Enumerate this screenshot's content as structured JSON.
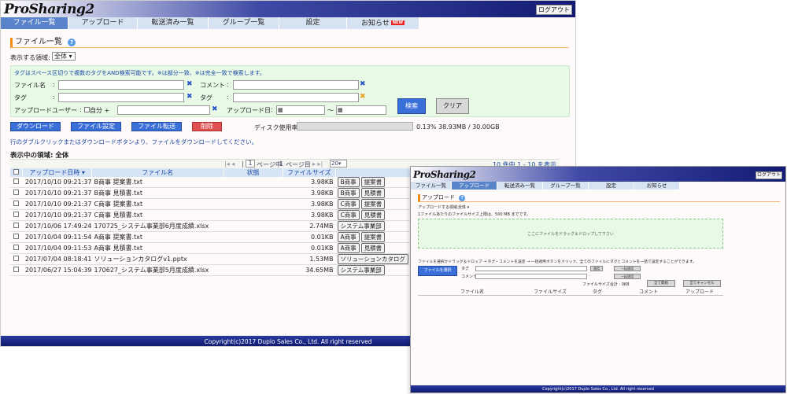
{
  "main": {
    "logo": "ProSharing2",
    "logout": "ログアウト",
    "nav": [
      "ファイル一覧",
      "アップロード",
      "転送済み一覧",
      "グループ一覧",
      "設定",
      "お知らせ"
    ],
    "new_badge": "NEW",
    "title": "ファイル一覧",
    "scope_label": "表示する領域:",
    "scope_value": "全体",
    "search_hint": "タグはスペース区切りで複数のタグをAND検索可能です。※は部分一致、※は完全一致で検索します。",
    "labels": {
      "filename": "ファイル名",
      "comment": "コメント",
      "tag1": "タグ",
      "tag2": "タグ",
      "uploader": "アップロードユーザー",
      "self": "自分",
      "date": "アップロード日"
    },
    "colon": ":",
    "x_mark": "✖",
    "tilde": "〜",
    "search_btn": "検索",
    "clear_btn": "クリア",
    "actions": [
      "ダウンロード",
      "ファイル設定",
      "ファイル転送",
      "削除"
    ],
    "disk_label": "ディスク使用率:",
    "disk_usage": "0.13%",
    "disk_detail": "38.93MB / 30.00GB",
    "hint": "行のダブルクリックまたはダウンロードボタンより、ファイルをダウンロードしてください。",
    "current_scope": "表示中の領域: 全体",
    "pager": {
      "page": "1",
      "total": "1",
      "text_pre": "ページ中",
      "text_post": "ページ目",
      "per_page": "20",
      "range": "10 件中 1 - 10 を表示"
    },
    "table_headers": [
      "アップロード日時",
      "ファイル名",
      "状態",
      "ファイルサイズ"
    ],
    "rows": [
      {
        "date": "2017/10/10 09:21:37",
        "name": "B商事 提案書.txt",
        "size": "3.98KB",
        "b1": "B商事",
        "b2": "提案書"
      },
      {
        "date": "2017/10/10 09:21:37",
        "name": "B商事 見積書.txt",
        "size": "3.98KB",
        "b1": "B商事",
        "b2": "見積書"
      },
      {
        "date": "2017/10/10 09:21:37",
        "name": "C商事 提案書.txt",
        "size": "3.98KB",
        "b1": "C商事",
        "b2": "提案書"
      },
      {
        "date": "2017/10/10 09:21:37",
        "name": "C商事 見積書.txt",
        "size": "3.98KB",
        "b1": "C商事",
        "b2": "見積書"
      },
      {
        "date": "2017/10/06 17:49:24",
        "name": "170725_システム事業部6月度成績.xlsx",
        "size": "2.74MB",
        "b1": "システム事業部",
        "b2": ""
      },
      {
        "date": "2017/10/04 09:11:54",
        "name": "A商事 提案書.txt",
        "size": "0.01KB",
        "b1": "A商事",
        "b2": "提案書"
      },
      {
        "date": "2017/10/04 09:11:53",
        "name": "A商事 見積書.txt",
        "size": "0.01KB",
        "b1": "A商事",
        "b2": "見積書"
      },
      {
        "date": "2017/07/04 08:18:41",
        "name": "ソリューションカタログv1.pptx",
        "size": "1.53MB",
        "b1": "ソリューションカタログ",
        "b2": ""
      },
      {
        "date": "2017/06/27 15:04:39",
        "name": "170627_システム事業部5月度成績.xlsx",
        "size": "34.65MB",
        "b1": "システム事業部",
        "b2": ""
      }
    ],
    "footer": "Copyright(c)2017 Duplo Sales Co., Ltd. All right reserved"
  },
  "upload": {
    "logo": "ProSharing2",
    "logout": "ログアウト",
    "nav": [
      "ファイル一覧",
      "アップロード",
      "転送済み一覧",
      "グループ一覧",
      "設定",
      "お知らせ"
    ],
    "title": "アップロード",
    "scope_label": "アップロードする領域:",
    "scope_value": "全体",
    "limit_note": "1ファイルあたりのファイルサイズ上限は、500 MB までです。",
    "dropzone": "ここにファイルをドラッグ＆ドロップして下さい",
    "steps": "ファイルを選択かドラッグ＆ドロップ → タグ・コメントを設定 → 一括適用ボタンをクリック、全てのファイルにタグとコメントを一括で設定することができます。",
    "select_btn": "ファイルを選択",
    "tag_label": "タグ",
    "comment_label": "コメント",
    "apply_btn_small": "適用",
    "apply_all_btn": "一括適用",
    "apply_all_btn2": "一括適用",
    "total_size": "ファイルサイズ合計 : 0KB",
    "start_btn": "全て開始",
    "cancel_btn": "全てキャンセル",
    "headers": [
      "ファイル名",
      "ファイルサイズ",
      "タグ",
      "コメント",
      "アップロード"
    ],
    "footer": "Copyright(c)2017 Duplo Sales Co., Ltd. All right reserved"
  }
}
